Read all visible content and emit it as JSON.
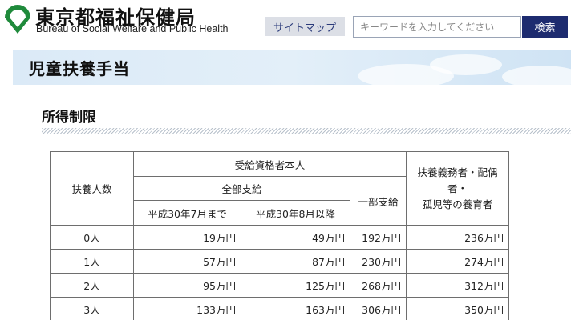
{
  "header": {
    "org_name_ja": "東京都福祉保健局",
    "org_name_en": "Bureau of Social Welfare and Public Health",
    "logo_icon": "tokyo-ginkgo-logo-icon",
    "sitemap_label": "サイトマップ",
    "search_placeholder": "キーワードを入力してください",
    "search_button_label": "検索"
  },
  "page": {
    "title": "児童扶養手当",
    "section_title": "所得制限"
  },
  "table": {
    "col_dependents": "扶養人数",
    "col_recipient": "受給資格者本人",
    "col_full_payment": "全部支給",
    "col_until": "平成30年7月まで",
    "col_from": "平成30年8月以降",
    "col_partial": "一部支給",
    "col_supporter_line1": "扶養義務者・配偶者・",
    "col_supporter_line2": "孤児等の養育者",
    "rows": [
      {
        "dependents": "0人",
        "until": "19万円",
        "from": "49万円",
        "partial": "192万円",
        "supporter": "236万円"
      },
      {
        "dependents": "1人",
        "until": "57万円",
        "from": "87万円",
        "partial": "230万円",
        "supporter": "274万円"
      },
      {
        "dependents": "2人",
        "until": "95万円",
        "from": "125万円",
        "partial": "268万円",
        "supporter": "312万円"
      },
      {
        "dependents": "3人",
        "until": "133万円",
        "from": "163万円",
        "partial": "306万円",
        "supporter": "350万円"
      }
    ]
  },
  "colors": {
    "search_button_bg": "#1d2b6f",
    "sitemap_bg": "#dcdfe6",
    "logo_green": "#1f8a3b",
    "title_band": "#dbeaf7"
  }
}
